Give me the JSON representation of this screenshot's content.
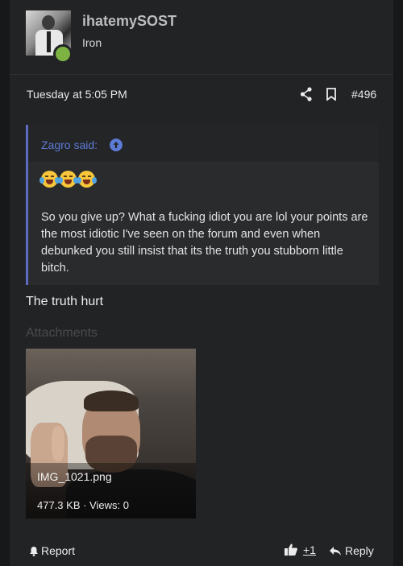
{
  "user": {
    "name": "ihatemySOST",
    "title": "Iron",
    "online_color": "#7cb342"
  },
  "meta": {
    "date": "Tuesday at 5:05 PM",
    "post_number": "#496"
  },
  "quote": {
    "author": "Zagro said:",
    "emojis": [
      "joy-tears",
      "joy-tears",
      "joy-tears"
    ],
    "text": "So you give up? What a fucking idiot you are lol your points are the most idiotic I've seen on the forum and even when debunked you still insist that its the truth you stubborn little bitch."
  },
  "body": {
    "text": "The truth hurt"
  },
  "attachments": {
    "label": "Attachments",
    "items": [
      {
        "filename": "IMG_1021.png",
        "meta": "477.3 KB · Views: 0"
      }
    ]
  },
  "footer": {
    "report_label": "Report",
    "like_count": "+1",
    "reply_label": "Reply"
  },
  "colors": {
    "accent": "#5c7bd6",
    "background": "#222325"
  }
}
